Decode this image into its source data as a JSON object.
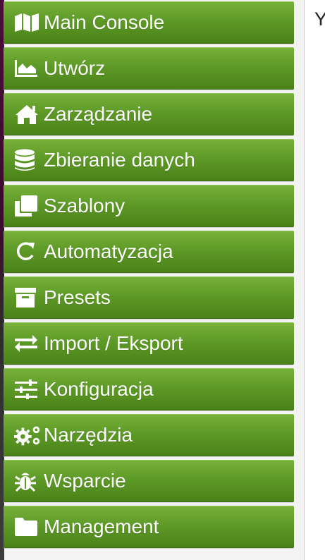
{
  "sidebar": {
    "items": [
      {
        "label": "Main Console",
        "icon": "map-icon"
      },
      {
        "label": "Utwórz",
        "icon": "area-chart-icon"
      },
      {
        "label": "Zarządzanie",
        "icon": "home-icon"
      },
      {
        "label": "Zbieranie danych",
        "icon": "database-icon"
      },
      {
        "label": "Szablony",
        "icon": "clone-icon"
      },
      {
        "label": "Automatyzacja",
        "icon": "refresh-icon"
      },
      {
        "label": "Presets",
        "icon": "archive-icon"
      },
      {
        "label": "Import / Eksport",
        "icon": "exchange-icon"
      },
      {
        "label": "Konfiguracja",
        "icon": "sliders-icon"
      },
      {
        "label": "Narzędzia",
        "icon": "gears-icon"
      },
      {
        "label": "Wsparcie",
        "icon": "bug-icon"
      },
      {
        "label": "Management",
        "icon": "folder-icon"
      }
    ]
  },
  "content": {
    "clipped_text": "Y"
  },
  "colors": {
    "menu_green_top": "#78b13a",
    "menu_green_bottom": "#4a8218",
    "menu_text": "#ffffff",
    "sidebar_bg": "#f3f3f3"
  }
}
